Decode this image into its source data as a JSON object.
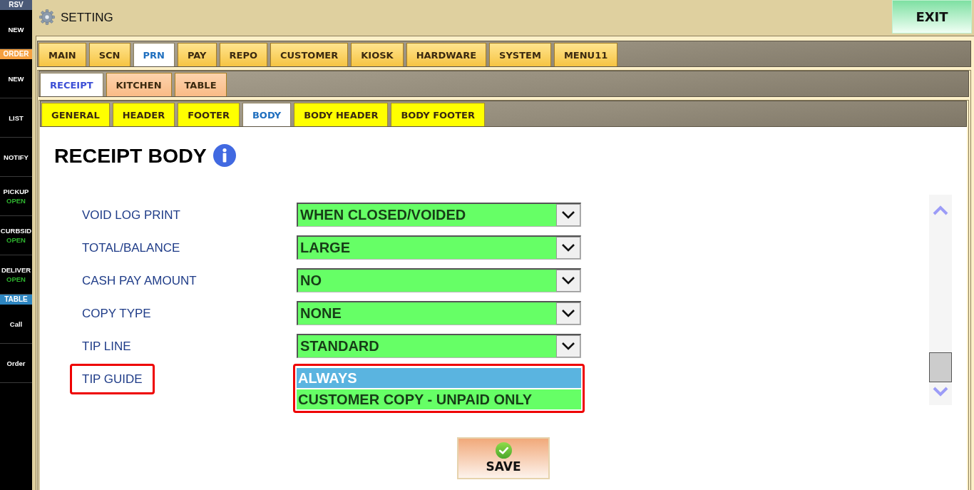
{
  "sidebar": {
    "sections": [
      {
        "header": "RSV",
        "color": "#4b5a78",
        "items": [
          {
            "label": "NEW"
          }
        ]
      },
      {
        "header": "ORDER",
        "color": "#f5a040",
        "items": [
          {
            "label": "NEW"
          },
          {
            "label": "LIST"
          },
          {
            "label": "NOTIFY"
          },
          {
            "label": "PICKUP",
            "status": "OPEN"
          },
          {
            "label": "CURBSID",
            "status": "OPEN"
          },
          {
            "label": "DELIVER",
            "status": "OPEN"
          }
        ]
      },
      {
        "header": "TABLE",
        "color": "#2e86c1",
        "items": [
          {
            "label": "Call"
          },
          {
            "label": "Order"
          }
        ]
      }
    ]
  },
  "header": {
    "title": "SETTING",
    "exit_button": "EXIT"
  },
  "tabs": [
    {
      "label": "MAIN",
      "selected": false
    },
    {
      "label": "SCN",
      "selected": false
    },
    {
      "label": "PRN",
      "selected": true
    },
    {
      "label": "PAY",
      "selected": false
    },
    {
      "label": "REPO",
      "selected": false
    },
    {
      "label": "CUSTOMER",
      "selected": false
    },
    {
      "label": "KIOSK",
      "selected": false
    },
    {
      "label": "HARDWARE",
      "selected": false
    },
    {
      "label": "SYSTEM",
      "selected": false
    },
    {
      "label": "MENU11",
      "selected": false
    }
  ],
  "print_tabs": [
    {
      "label": "RECEIPT",
      "selected": true
    },
    {
      "label": "KITCHEN",
      "selected": false
    },
    {
      "label": "TABLE",
      "selected": false
    }
  ],
  "receipt_tabs": [
    {
      "label": "GENERAL",
      "selected": false
    },
    {
      "label": "HEADER",
      "selected": false
    },
    {
      "label": "FOOTER",
      "selected": false
    },
    {
      "label": "BODY",
      "selected": true
    },
    {
      "label": "BODY HEADER",
      "selected": false
    },
    {
      "label": "BODY FOOTER",
      "selected": false
    }
  ],
  "content": {
    "title": "RECEIPT BODY",
    "settings": [
      {
        "label": "VOID LOG PRINT",
        "kind": "dropdown",
        "value": "WHEN CLOSED/VOIDED",
        "highlighted": false
      },
      {
        "label": "TOTAL/BALANCE",
        "kind": "dropdown",
        "value": "LARGE",
        "highlighted": false
      },
      {
        "label": "CASH PAY AMOUNT",
        "kind": "dropdown",
        "value": "NO",
        "highlighted": false
      },
      {
        "label": "COPY TYPE",
        "kind": "dropdown",
        "value": "NONE",
        "highlighted": false
      },
      {
        "label": "TIP LINE",
        "kind": "dropdown",
        "value": "STANDARD",
        "highlighted": false
      },
      {
        "label": "TIP GUIDE",
        "kind": "listbox",
        "highlighted": true,
        "options": [
          {
            "label": "ALWAYS",
            "selected": true
          },
          {
            "label": "CUSTOMER COPY - UNPAID ONLY",
            "selected": false
          }
        ]
      }
    ],
    "save_button": "SAVE"
  }
}
